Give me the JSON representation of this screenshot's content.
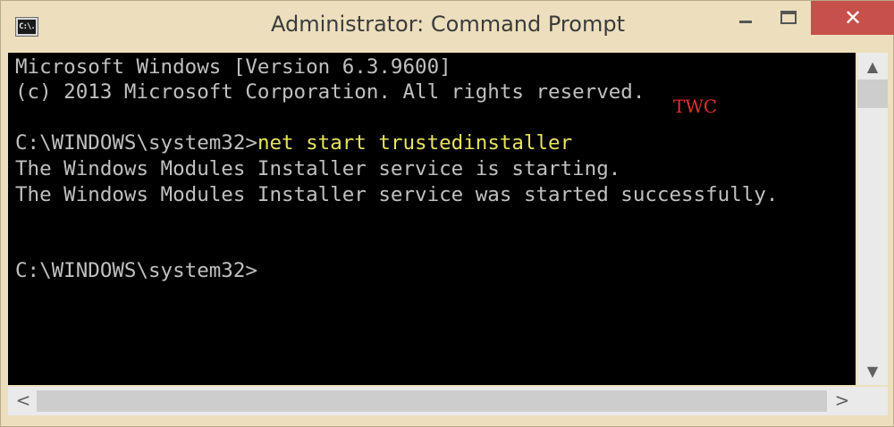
{
  "window": {
    "title": "Administrator: Command Prompt",
    "icon": "cmd-icon",
    "icon_text": "C:\\.",
    "controls": {
      "minimize_icon": "minimize-icon",
      "maximize_icon": "maximize-icon",
      "close_icon": "close-icon",
      "close_glyph": "✕",
      "close_color": "#c7504b"
    }
  },
  "console": {
    "background": "#000000",
    "text_color": "#c0c0c0",
    "command_color": "#e7e35e",
    "lines": [
      {
        "text": "Microsoft Windows [Version 6.3.9600]"
      },
      {
        "text": "(c) 2013 Microsoft Corporation. All rights reserved."
      },
      {
        "text": ""
      },
      {
        "prompt": "C:\\WINDOWS\\system32>",
        "command": "net start trustedinstaller"
      },
      {
        "text": "The Windows Modules Installer service is starting."
      },
      {
        "text": "The Windows Modules Installer service was started successfully."
      },
      {
        "text": ""
      },
      {
        "text": ""
      },
      {
        "prompt": "C:\\WINDOWS\\system32>",
        "command": ""
      }
    ],
    "watermark": "TWC",
    "watermark_color": "#e0312c"
  },
  "scrollbars": {
    "up_glyph": "▲",
    "down_glyph": "▼",
    "left_glyph": "<",
    "right_glyph": ">"
  }
}
